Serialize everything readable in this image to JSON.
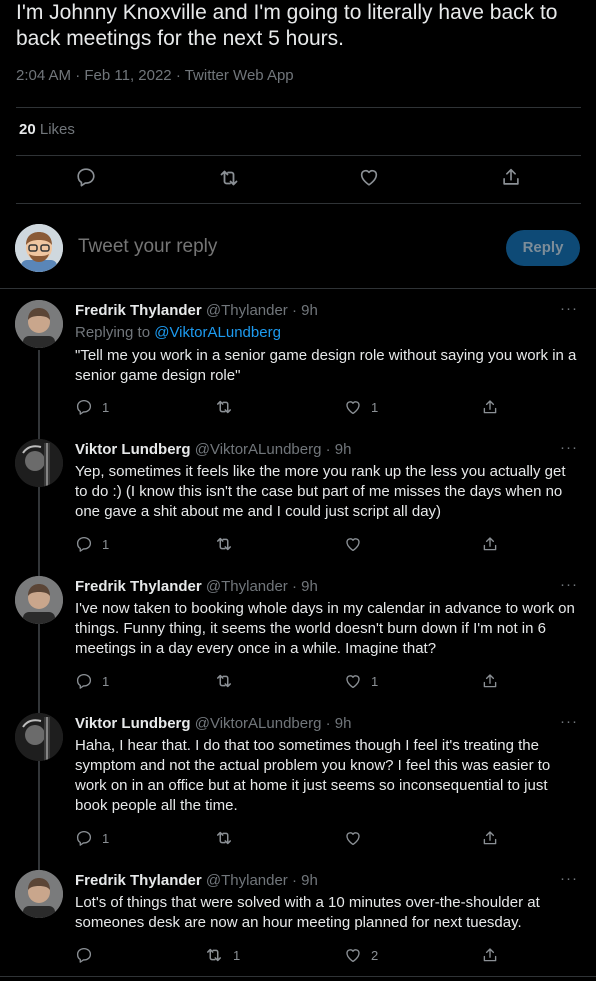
{
  "tweet": {
    "text": "I'm Johnny Knoxville and I'm going to literally have back to back meetings for the next 5 hours.",
    "meta": "2:04 AM · Feb 11, 2022 · Twitter Web App",
    "likes_count": "20",
    "likes_label": "Likes"
  },
  "reply_bar": {
    "placeholder": "Tweet your reply",
    "button_label": "Reply"
  },
  "replies": [
    {
      "name": "Fredrik Thylander",
      "handle": "@Thylander · 9h",
      "replying_prefix": "Replying to",
      "replying_to": "@ViktorALundberg",
      "text": "\"Tell me you work in a senior game design role without saying you work in a senior game design role\"",
      "reply_count": "1",
      "retweet_count": "",
      "like_count": "1"
    },
    {
      "name": "Viktor Lundberg",
      "handle": "@ViktorALundberg · 9h",
      "text": "Yep, sometimes it feels like the more you rank up the less you actually get to do :) (I know this isn't the case but part of me misses the days when no one gave a shit about me and I could just script all day)",
      "reply_count": "1",
      "retweet_count": "",
      "like_count": ""
    },
    {
      "name": "Fredrik Thylander",
      "handle": "@Thylander · 9h",
      "text": "I've now taken to booking whole days in my calendar in advance to work on things. Funny thing, it seems the world doesn't burn down if I'm not in 6 meetings in a day every once in a while. Imagine that?",
      "reply_count": "1",
      "retweet_count": "",
      "like_count": "1"
    },
    {
      "name": "Viktor Lundberg",
      "handle": "@ViktorALundberg · 9h",
      "text": "Haha, I hear that. I do that too sometimes though I feel it's treating the symptom and not the actual problem you know? I feel this was easier to work on in an office but at home it just seems so inconsequential to just book people all the time.",
      "reply_count": "1",
      "retweet_count": "",
      "like_count": ""
    },
    {
      "name": "Fredrik Thylander",
      "handle": "@Thylander · 9h",
      "text": "Lot's of things that were solved with a 10 minutes over-the-shoulder at someones desk are now an hour meeting planned for next tuesday.",
      "reply_count": "",
      "retweet_count": "1",
      "like_count": "2"
    }
  ],
  "icons": {
    "reply": "speech-bubble-icon",
    "retweet": "retweet-arrows-icon",
    "like": "heart-icon",
    "share": "share-upload-icon",
    "more": "more-dots-icon"
  }
}
